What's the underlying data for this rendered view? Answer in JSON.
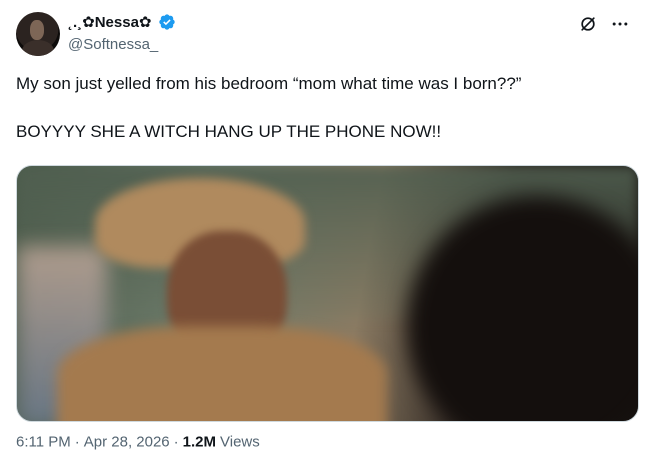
{
  "user": {
    "display_name": "˛.¸✿Nessa✿ ",
    "handle": "@Softnessa_",
    "verified": true,
    "avatar_icon": "profile-photo"
  },
  "actions": {
    "grok_icon": "grok-icon",
    "more_icon": "more-icon"
  },
  "tweet": {
    "lines": [
      "My son just yelled from his bedroom “mom what time was I born??”",
      "BOYYYY SHE A WITCH HANG UP THE PHONE NOW!!"
    ]
  },
  "meta": {
    "time": "6:11 PM",
    "separator": "·",
    "date": "Apr 28, 2026",
    "views_count": "1.2M",
    "views_label": "Views"
  },
  "colors": {
    "text_primary": "#0f1419",
    "text_secondary": "#536471",
    "verified": "#1d9bf0"
  }
}
